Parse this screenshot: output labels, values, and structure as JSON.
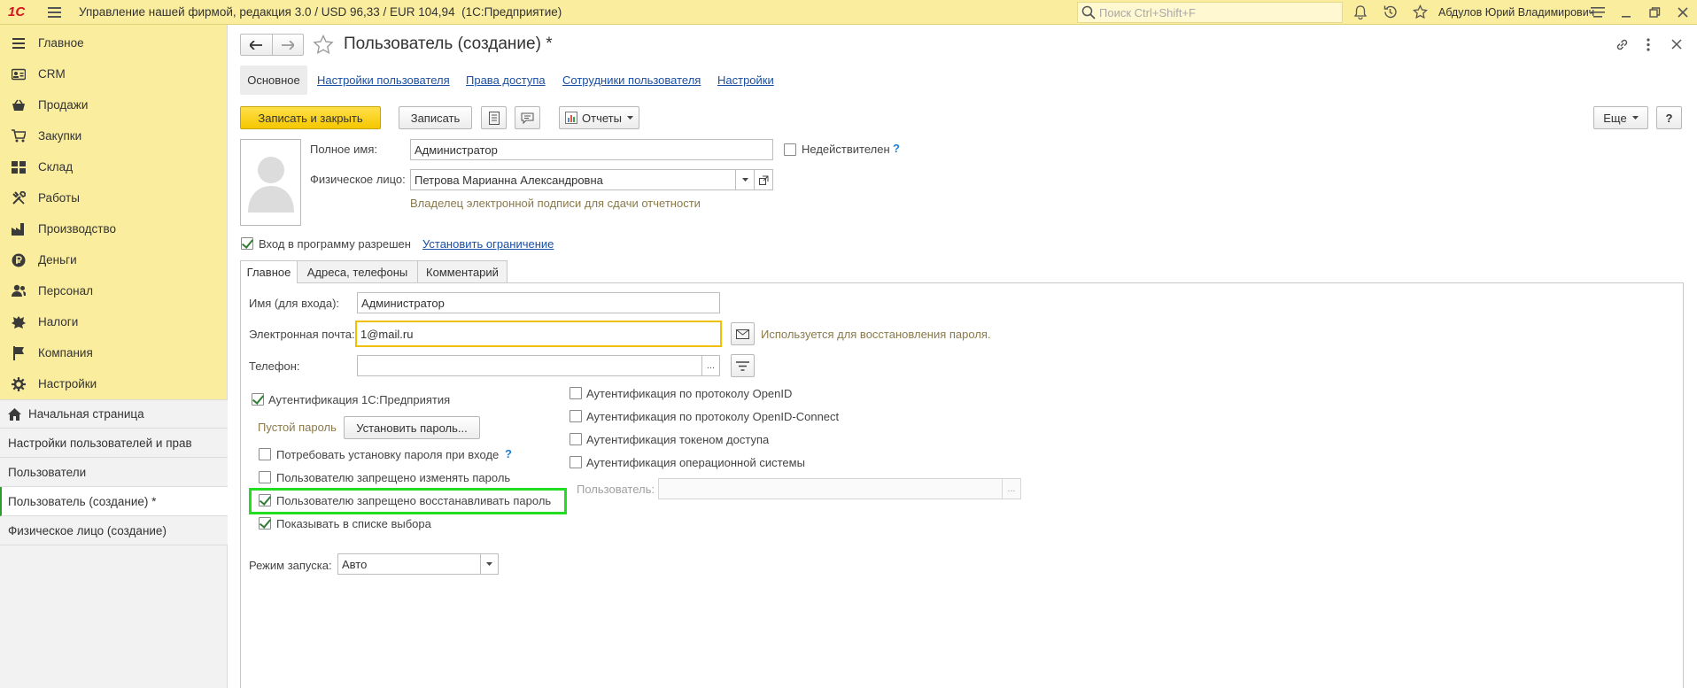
{
  "titlebar": {
    "logo": "1С",
    "title": "Управление нашей фирмой, редакция 3.0 / USD 96,33 / EUR 104,94  (1С:Предприятие)",
    "search_placeholder": "Поиск Ctrl+Shift+F",
    "user": "Абдулов Юрий Владимирович"
  },
  "sidebar": {
    "items": [
      {
        "label": "Главное",
        "icon": "menu-icon"
      },
      {
        "label": "CRM",
        "icon": "crm-icon"
      },
      {
        "label": "Продажи",
        "icon": "basket-icon"
      },
      {
        "label": "Закупки",
        "icon": "cart-icon"
      },
      {
        "label": "Склад",
        "icon": "warehouse-icon"
      },
      {
        "label": "Работы",
        "icon": "tools-icon"
      },
      {
        "label": "Производство",
        "icon": "factory-icon"
      },
      {
        "label": "Деньги",
        "icon": "coin-icon"
      },
      {
        "label": "Персонал",
        "icon": "people-icon"
      },
      {
        "label": "Налоги",
        "icon": "emblem-icon"
      },
      {
        "label": "Компания",
        "icon": "flag-icon"
      },
      {
        "label": "Настройки",
        "icon": "gear-icon"
      }
    ],
    "open_windows": [
      {
        "label": "Начальная страница",
        "icon": "home-icon"
      },
      {
        "label": "Настройки пользователей и прав"
      },
      {
        "label": "Пользователи"
      },
      {
        "label": "Пользователь (создание) *",
        "active": true
      },
      {
        "label": "Физическое лицо (создание)"
      }
    ]
  },
  "form": {
    "title": "Пользователь (создание) *",
    "tabs_top": [
      "Основное",
      "Настройки пользователя",
      "Права доступа",
      "Сотрудники пользователя",
      "Настройки"
    ],
    "toolbar": {
      "save_close": "Записать и закрыть",
      "save": "Записать",
      "reports": "Отчеты",
      "more": "Еще",
      "help": "?"
    },
    "full_name_label": "Полное имя:",
    "full_name_value": "Администратор",
    "invalid_label": "Недействителен",
    "invalid_help": "?",
    "person_label": "Физическое лицо:",
    "person_value": "Петрова Марианна Александровна",
    "person_hint": "Владелец электронной подписи для сдачи отчетности",
    "login_allowed_label": "Вход в программу разрешен",
    "set_restriction_link": "Установить ограничение",
    "inner_tabs": [
      "Главное",
      "Адреса, телефоны",
      "Комментарий"
    ],
    "login_name_label": "Имя (для входа):",
    "login_name_value": "Администратор",
    "email_label": "Электронная почта:",
    "email_value": "1@mail.ru",
    "email_hint": "Используется для восстановления пароля.",
    "phone_label": "Телефон:",
    "phone_value": "",
    "ellipsis": "...",
    "auth_1c_label": "Аутентификация 1С:Предприятия",
    "empty_password_label": "Пустой пароль",
    "set_password_button": "Установить пароль...",
    "require_password_label": "Потребовать установку пароля при входе",
    "require_password_help": "?",
    "deny_change_label": "Пользователю запрещено изменять пароль",
    "deny_restore_label": "Пользователю запрещено восстанавливать пароль",
    "show_in_list_label": "Показывать в списке выбора",
    "auth_openid_label": "Аутентификация по протоколу OpenID",
    "auth_openid_connect_label": "Аутентификация по протоколу OpenID-Connect",
    "auth_token_label": "Аутентификация токеном доступа",
    "auth_os_label": "Аутентификация операционной системы",
    "os_user_label": "Пользователь:",
    "os_user_value": "",
    "launch_mode_label": "Режим запуска:",
    "launch_mode_value": "Авто",
    "checks": {
      "invalid": false,
      "login_allowed": true,
      "auth_1c": true,
      "require_password": false,
      "deny_change": false,
      "deny_restore": true,
      "show_in_list": true,
      "auth_openid": false,
      "auth_openid_connect": false,
      "auth_token": false,
      "auth_os": false
    }
  },
  "colors": {
    "topbar": "#fbed9e",
    "accent_yellow": "#f5c800",
    "link": "#1a4fa3",
    "highlight_green": "#22dd22",
    "email_focus": "#f0c000"
  }
}
